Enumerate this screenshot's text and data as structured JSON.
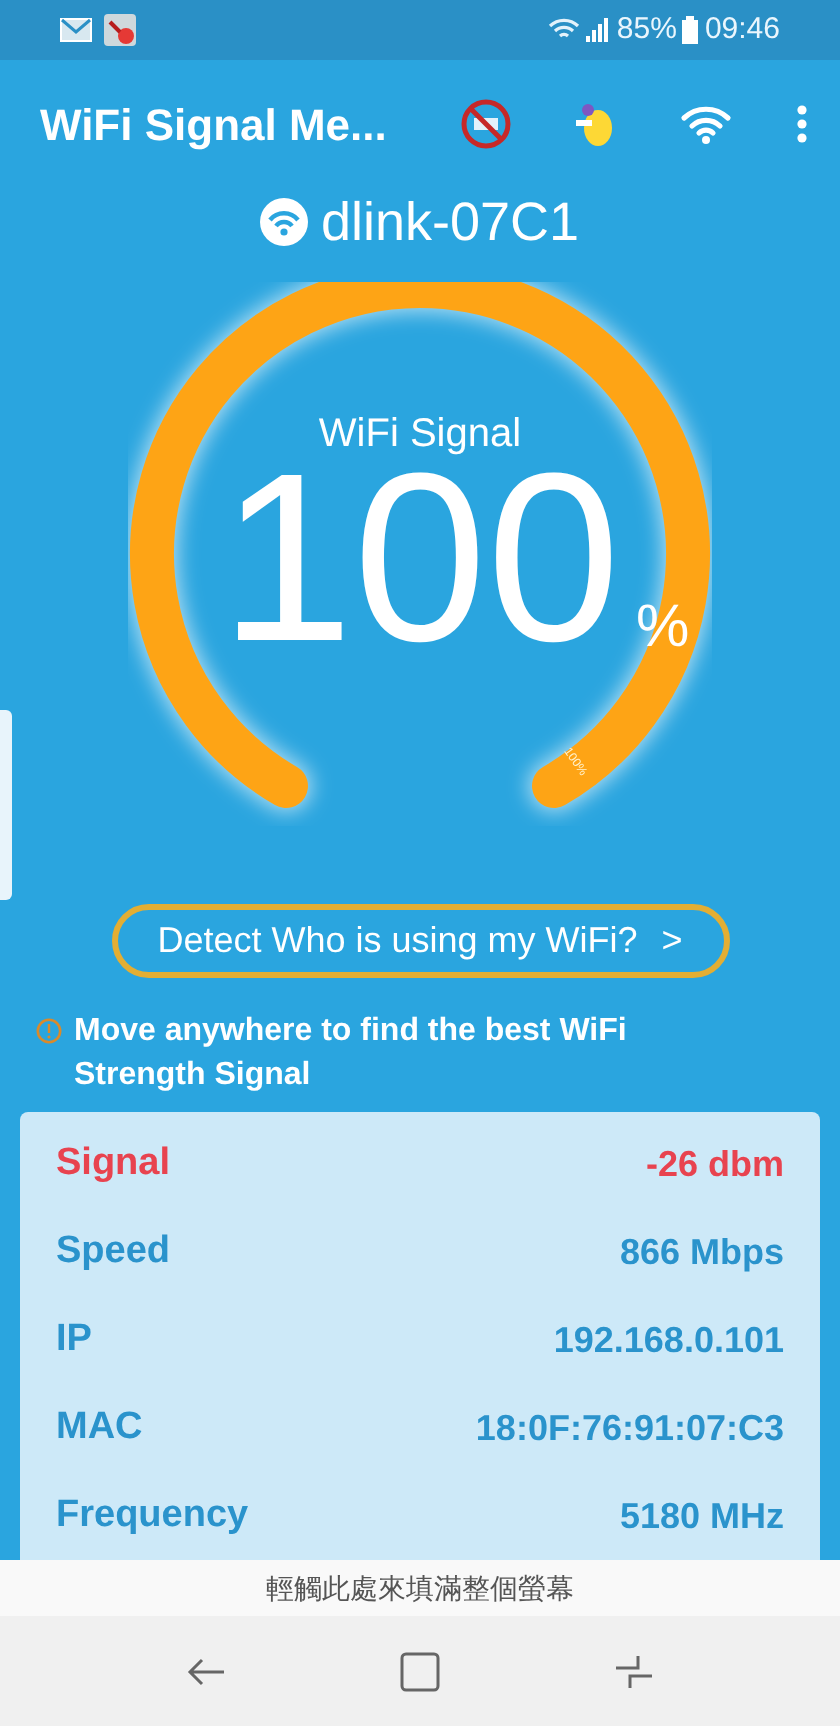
{
  "status_bar": {
    "battery": "85%",
    "time": "09:46"
  },
  "app_bar": {
    "title": "WiFi Signal Me..."
  },
  "network": {
    "name": "dlink-07C1"
  },
  "gauge": {
    "label": "WiFi Signal",
    "value": "100",
    "unit": "%",
    "end_label": "100%"
  },
  "detect_button": {
    "label": "Detect Who is using my WiFi?",
    "chevron": ">"
  },
  "tip": {
    "text": "Move anywhere to find the best WiFi Strength Signal"
  },
  "details": [
    {
      "label": "Signal",
      "value": "-26 dbm",
      "alert": true
    },
    {
      "label": "Speed",
      "value": "866 Mbps",
      "alert": false
    },
    {
      "label": "IP",
      "value": "192.168.0.101",
      "alert": false
    },
    {
      "label": "MAC",
      "value": "18:0F:76:91:07:C3",
      "alert": false
    },
    {
      "label": "Frequency",
      "value": "5180 MHz",
      "alert": false
    }
  ],
  "fullscreen_hint": "輕觸此處來填滿整個螢幕"
}
